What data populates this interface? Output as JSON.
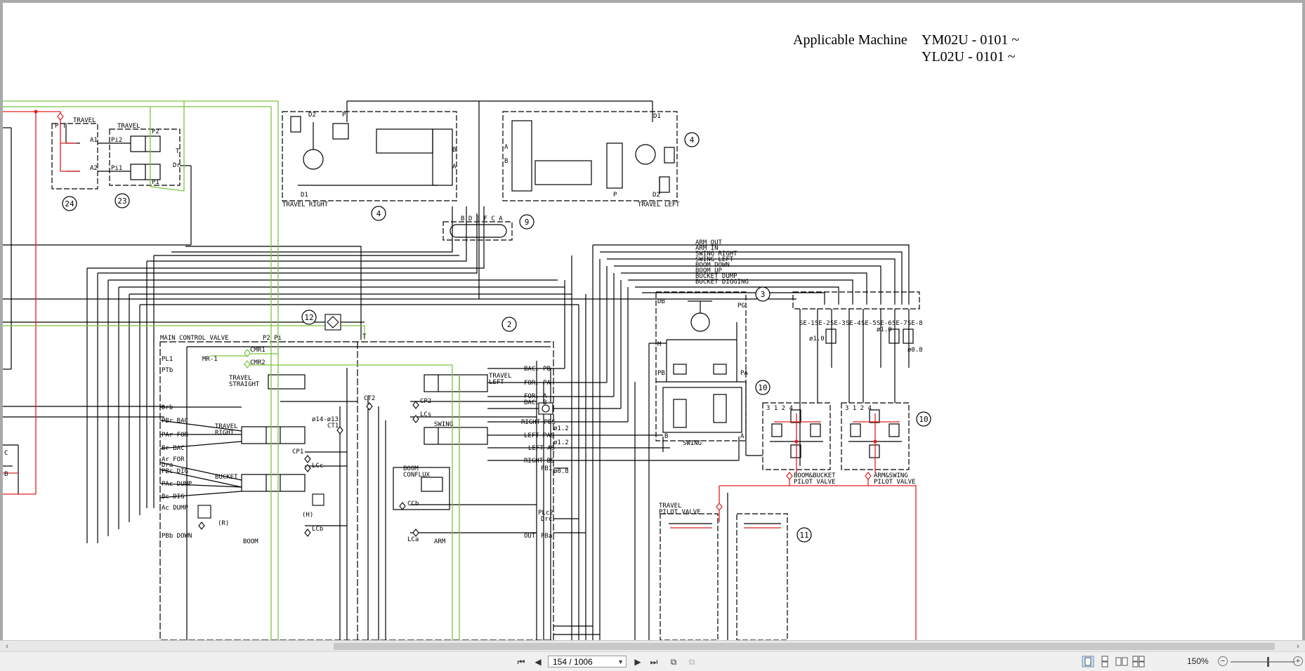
{
  "document": {
    "applicable_label": "Applicable Machine",
    "model_line_1": "YM02U - 0101 ~",
    "model_line_2": "YL02U - 0101 ~"
  },
  "schematic": {
    "balloons": [
      "24",
      "23",
      "4",
      "4",
      "9",
      "3",
      "12",
      "2",
      "10",
      "10",
      "11"
    ],
    "labels": {
      "travel_a": "TRAVEL",
      "travel_b": "TRAVEL",
      "pt": "P T",
      "p2": "P2",
      "p1": "P1",
      "a1": "A1",
      "a2": "A2",
      "pi2": "Pi2",
      "pi1": "Pi1",
      "t": "T",
      "dr": "Dr",
      "d2_left": "D2",
      "d1_left": "D1",
      "p_left": "P",
      "b_left": "B",
      "a_left": "A",
      "travel_right": "TRAVEL RIGHT",
      "d1_right": "D1",
      "d2_right": "D2",
      "a_right": "A",
      "b_right": "B",
      "p_right": "P",
      "travel_left": "TRAVEL LEFT",
      "swivel_ports": "B D E F C A",
      "main_control_valve": "MAIN CONTROL VALVE",
      "p2_pi": "P2   Pi",
      "t_mcv": "T",
      "mr1": "MR-1",
      "cmr1": "CMR1",
      "cmr2": "CMR2",
      "pl1": "PL1",
      "ptb": "PTb",
      "travel_straight": "TRAVEL\nSTRAIGHT",
      "drb": "Drb",
      "pbr_bac": "PBr BAC",
      "par_for": "PAr FOR",
      "br_bac": "Br BAC",
      "ar_for": "Ar FOR",
      "dra": "Dra",
      "pbc_dig": "PBc DIG",
      "pac_dump": "PAc DUMP",
      "bc_dig": "Bc DIG",
      "ac_dump": "Ac DUMP",
      "pbb_down": "PBb DOWN",
      "travel_right_spool": "TRAVEL\nRIGHT",
      "bucket": "BUCKET",
      "r_mark": "(R)",
      "h_mark": "(H)",
      "boom": "BOOM",
      "ct2": "CT2",
      "ct1": "CT1",
      "dia_14_13": "ø14-ø13",
      "cp1": "CP1",
      "lcc": "LCc",
      "lcb": "LCb",
      "cp2": "CP2",
      "lcs": "LCs",
      "swing_spool": "SWING",
      "boom_conflux": "BOOM\nCONFLUX",
      "ccb": "CCb",
      "lca": "LCa",
      "arm": "ARM",
      "travel_left_spool": "TRAVEL\nLEFT",
      "bac_pb": "BAC. PB",
      "for_pa": "FOR. PA",
      "for_a": "FOR. A",
      "bac_b": "BAC. B",
      "right_pbs": "RIGHT PBS",
      "left_pas": "LEFT PAS",
      "left_as": "LEFT AS",
      "right_bs": "RIGHT BS",
      "pb1": "PB1",
      "dia_1_2_a": "ø1.2",
      "dia_1_2_b": "ø1.2",
      "dia_0_8": "ø0.8",
      "plc2": "PLc2",
      "drc": "Drc",
      "out": "OUT",
      "pba": "PBa",
      "db": "DB",
      "pg": "PG",
      "m": "M",
      "pb": "PB",
      "pa": "PA",
      "b_sw": "B",
      "a_sw": "A",
      "swing_motor": "SWING",
      "sig_list": [
        "ARM OUT",
        "ARM IN",
        "SWING RIGHT",
        "SWING LEFT",
        "BOOM DOWN",
        "BOOM UP",
        "BUCKET DUMP",
        "BUCKET DIGGING"
      ],
      "se": [
        "SE-1",
        "SE-2",
        "SE-3",
        "SE-4",
        "SE-5",
        "SE-6",
        "SE-7",
        "SE-8"
      ],
      "dia_1_0_a": "ø1.0",
      "dia_1_0_b": "ø1.0",
      "dia_0_8_b": "ø0.8",
      "boom_bucket_pv": "BOOM&BUCKET\nPILOT VALVE",
      "arm_swing_pv": "ARM&SWING\nPILOT VALVE",
      "travel_pv": "TRAVEL\nPILOT VALVE",
      "pv_ports": "3 1 2 4",
      "c_mark": "C",
      "b_mark": "B"
    }
  },
  "viewer": {
    "page_indicator": "154 / 1006",
    "zoom": "150%"
  }
}
